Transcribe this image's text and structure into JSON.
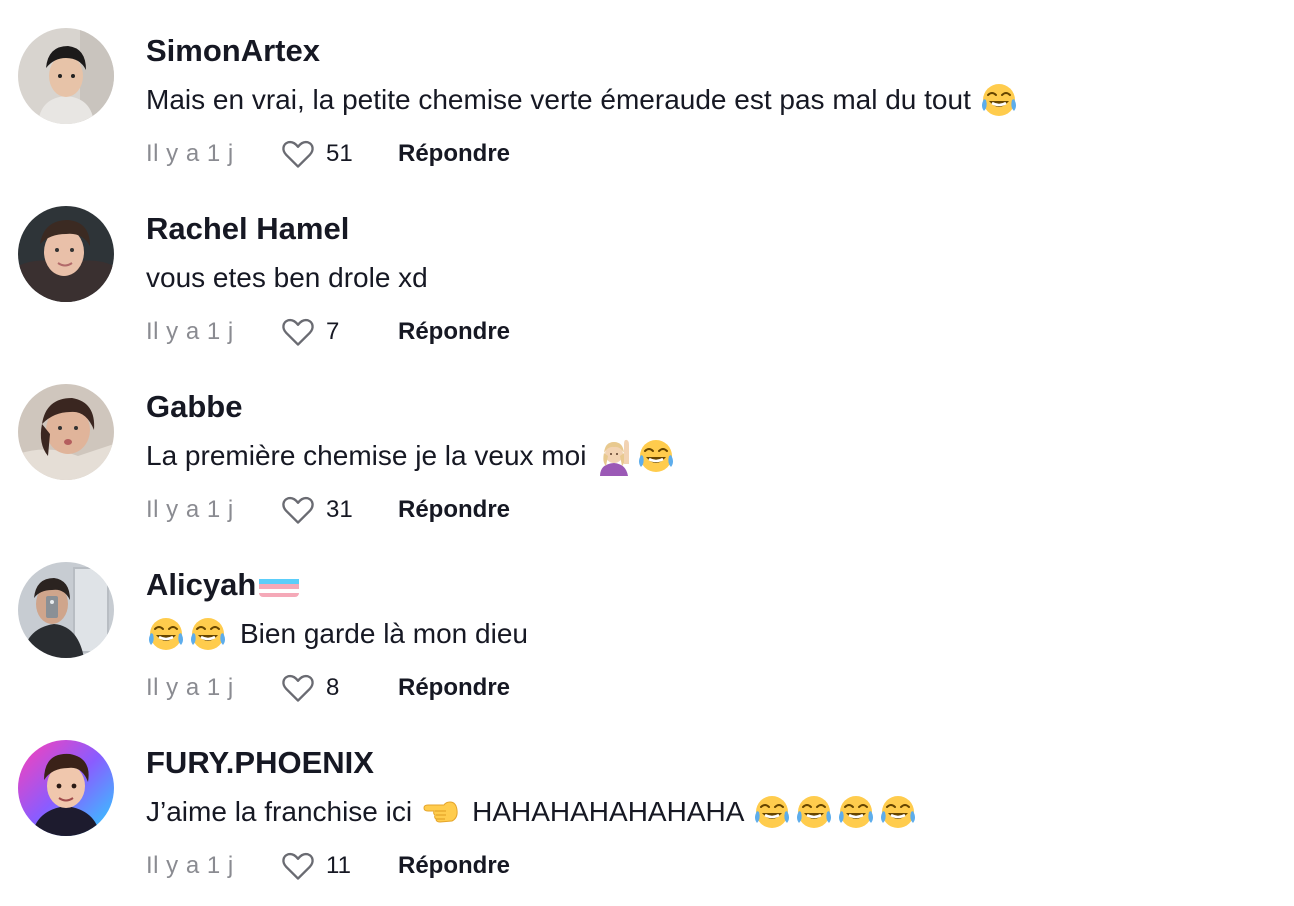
{
  "comments": [
    {
      "username": "SimonArtex",
      "text": "Mais en vrai, la petite chemise verte émeraude est pas mal du tout",
      "trailing_emojis": [
        "face-with-tears-of-joy"
      ],
      "time": "Il y a 1 j",
      "likes": "51",
      "reply_label": "Répondre"
    },
    {
      "username": "Rachel Hamel",
      "text": "vous etes ben drole xd",
      "trailing_emojis": [],
      "time": "Il y a 1 j",
      "likes": "7",
      "reply_label": "Répondre"
    },
    {
      "username": "Gabbe",
      "text": "La première chemise je la veux moi",
      "trailing_emojis": [
        "person-raising-hand",
        "face-with-tears-of-joy"
      ],
      "time": "Il y a 1 j",
      "likes": "31",
      "reply_label": "Répondre"
    },
    {
      "username": "Alicyah",
      "username_badge": "transgender-flag",
      "text": "Bien garde là mon dieu",
      "leading_emojis": [
        "face-with-tears-of-joy",
        "face-with-tears-of-joy"
      ],
      "time": "Il y a 1 j",
      "likes": "8",
      "reply_label": "Répondre"
    },
    {
      "username": "FURY.PHOENIX",
      "text": "J’aime la franchise ici",
      "mid_emoji": "backhand-index-pointing-left",
      "text_after": "HAHAHAHAHAHAHA",
      "trailing_emojis": [
        "face-with-tears-of-joy",
        "face-with-tears-of-joy",
        "face-with-tears-of-joy",
        "face-with-tears-of-joy"
      ],
      "time": "Il y a 1 j",
      "likes": "11",
      "reply_label": "Répondre"
    }
  ],
  "colors": {
    "text_primary": "#161823",
    "text_secondary": "#8a8b91",
    "background": "#ffffff"
  }
}
